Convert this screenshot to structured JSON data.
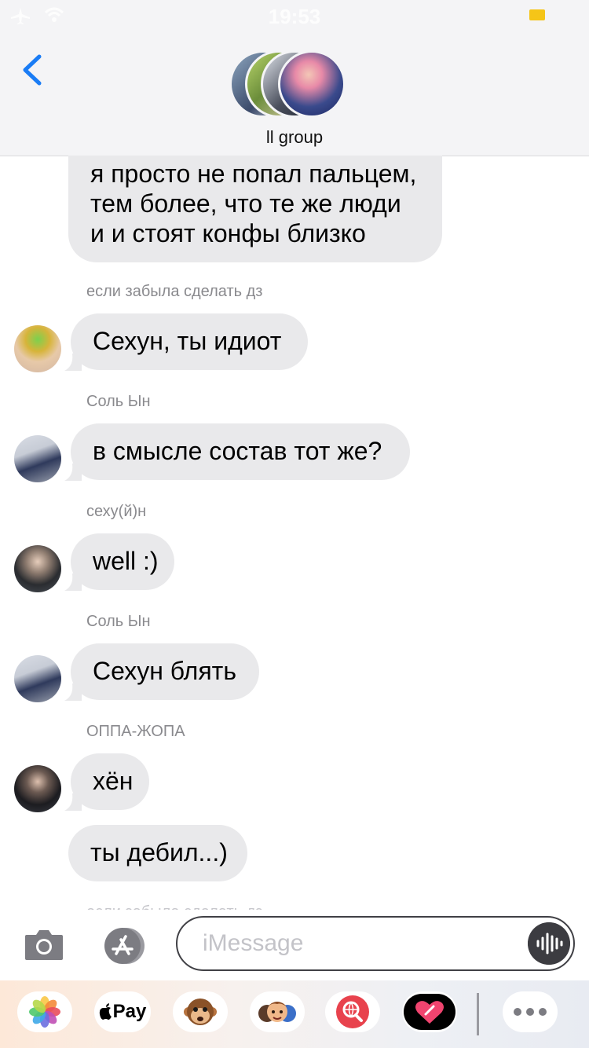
{
  "status_bar": {
    "time": "19:53"
  },
  "header": {
    "group_name": "ll group"
  },
  "messages": {
    "m1": {
      "text": "я просто не попал пальцем, тем более, что те же люди и и стоят конфы близко"
    },
    "m2": {
      "sender": "если забыла сделать дз",
      "text": "Сехун, ты идиот"
    },
    "m3": {
      "sender": "Соль Ын",
      "text": "в смысле состав тот же?"
    },
    "m4": {
      "sender": "сеху(й)н",
      "text": "well :)"
    },
    "m5": {
      "sender": "Соль Ын",
      "text": "Сехун блять"
    },
    "m6": {
      "sender": "ОППА-ЖОПА",
      "text": "хён"
    },
    "m7": {
      "text": "ты дебил...)"
    },
    "partial_sender": "если забыла сделать дз"
  },
  "composer": {
    "placeholder": "iMessage"
  },
  "app_drawer": {
    "apple_pay_label": "Pay"
  },
  "colors": {
    "bubble": "#e9e9eb",
    "accent_blue": "#1a7cf5",
    "battery": "#f5c518",
    "sender_gray": "#8a8a8e"
  }
}
